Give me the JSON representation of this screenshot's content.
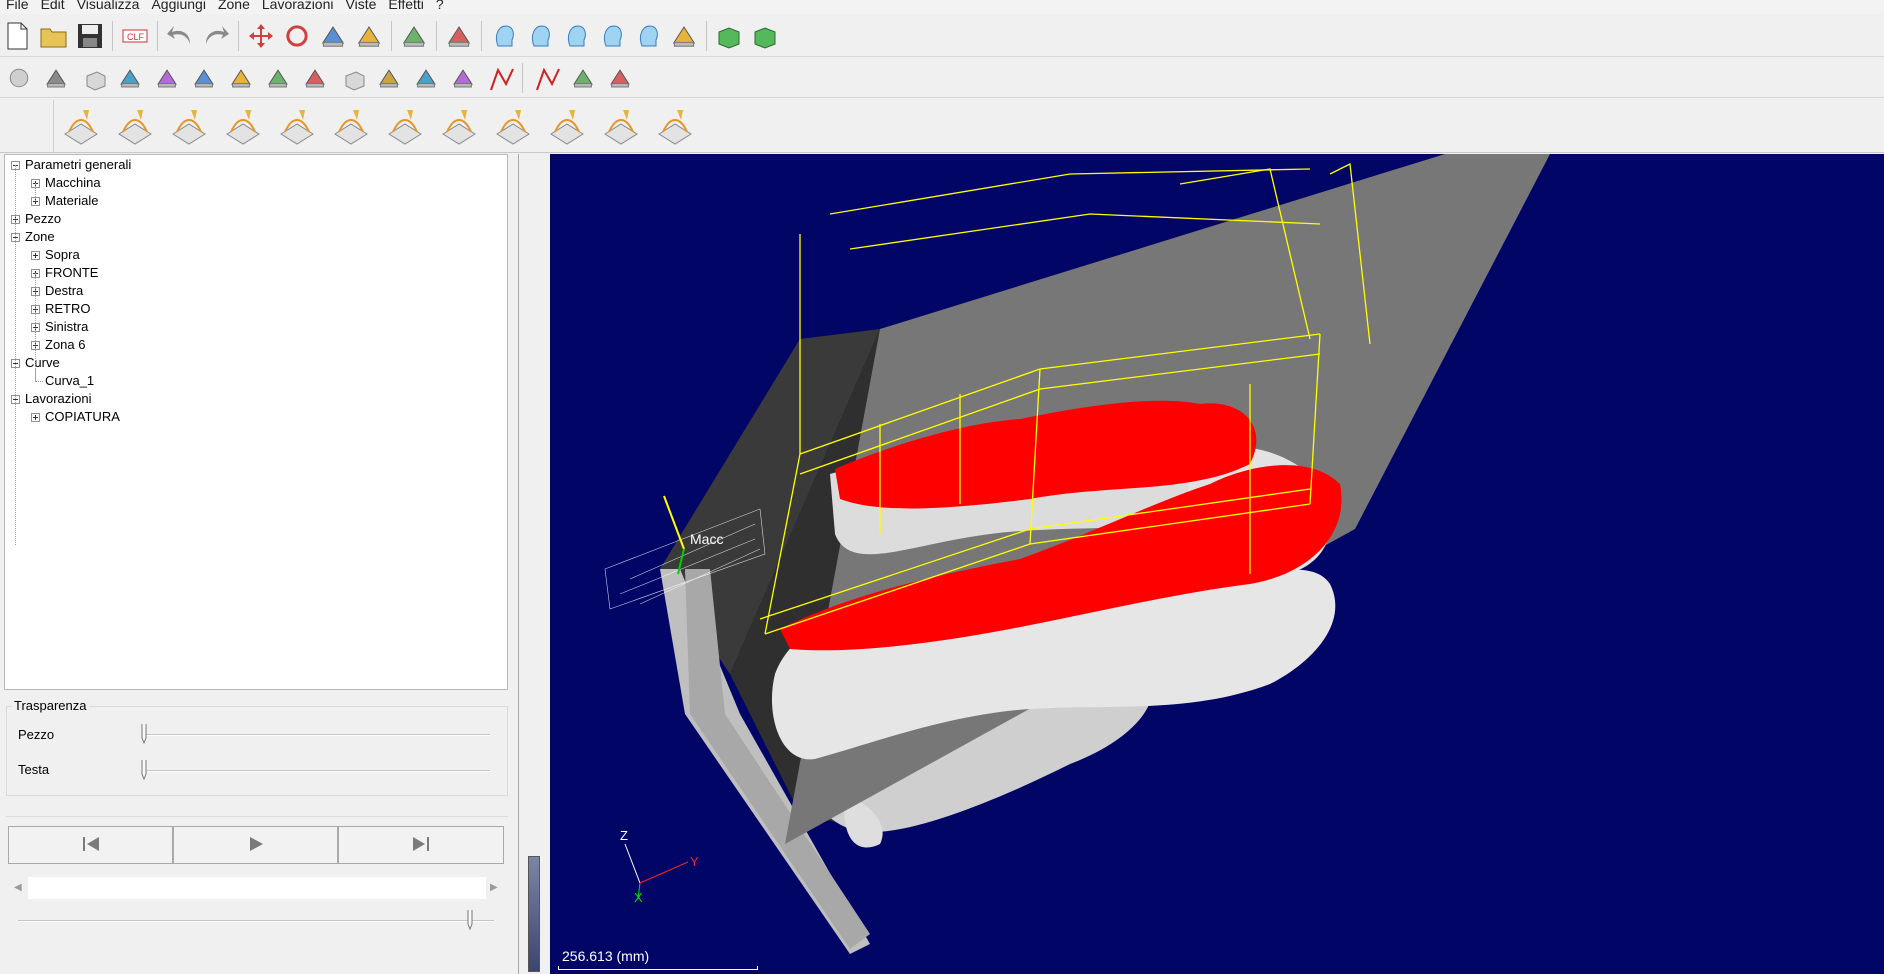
{
  "menu": [
    "File",
    "Edit",
    "Visualizza",
    "Aggiungi",
    "Zone",
    "Lavorazioni",
    "Viste",
    "Effetti",
    "?"
  ],
  "toolbar1": [
    {
      "name": "new-file-icon"
    },
    {
      "name": "open-folder-icon"
    },
    {
      "name": "save-icon"
    },
    {
      "name": "clf-import-icon"
    },
    {
      "name": "undo-icon"
    },
    {
      "name": "redo-icon"
    },
    {
      "name": "move-icon"
    },
    {
      "name": "rotate-icon"
    },
    {
      "name": "scale-icon"
    },
    {
      "name": "cut-icon"
    },
    {
      "name": "layers-icon"
    },
    {
      "name": "relief-icon"
    },
    {
      "name": "head-view-front-icon"
    },
    {
      "name": "head-view-right-icon"
    },
    {
      "name": "head-view-left-icon"
    },
    {
      "name": "hand-view-icon"
    },
    {
      "name": "hand-view-top-icon"
    },
    {
      "name": "plane-view-icon"
    },
    {
      "name": "box-green-icon"
    },
    {
      "name": "box-green-multi-icon"
    }
  ],
  "toolbar1_clf_label": "CLF",
  "toolbar2": [
    "sphere-icon",
    "cone-icon",
    "cube-icon",
    "funnel-icon",
    "plane-cut-icon",
    "dish-icon",
    "ribbon-icon",
    "torus-icon",
    "lathe-icon",
    "box-small-icon",
    "text-icon",
    "curve-surface-icon",
    "path-icon",
    "polyline-icon",
    "polygon-icon",
    "mold-icon",
    "knurl-icon"
  ],
  "toolbar3": [
    "roughing-icon",
    "zigzag-toolpath-icon",
    "pocket-icon",
    "flat-finish-icon",
    "spiral-cone-icon",
    "stepdown-icon",
    "pad-icon",
    "sphere-finish-icon",
    "vase-rotary-icon",
    "vase-rotary-arrows-icon",
    "cone-surface-icon",
    "axis-arrow-icon"
  ],
  "tree": {
    "items": [
      {
        "label": "Parametri generali",
        "level": 0,
        "state": "minus"
      },
      {
        "label": "Macchina",
        "level": 1,
        "state": "plus"
      },
      {
        "label": "Materiale",
        "level": 1,
        "state": "plus"
      },
      {
        "label": "Pezzo",
        "level": 0,
        "state": "plus"
      },
      {
        "label": "Zone",
        "level": 0,
        "state": "minus"
      },
      {
        "label": "Sopra",
        "level": 1,
        "state": "plus"
      },
      {
        "label": "FRONTE",
        "level": 1,
        "state": "plus"
      },
      {
        "label": "Destra",
        "level": 1,
        "state": "plus"
      },
      {
        "label": "RETRO",
        "level": 1,
        "state": "plus"
      },
      {
        "label": "Sinistra",
        "level": 1,
        "state": "plus"
      },
      {
        "label": "Zona 6",
        "level": 1,
        "state": "plus"
      },
      {
        "label": "Curve",
        "level": 0,
        "state": "minus"
      },
      {
        "label": "Curva_1",
        "level": 1,
        "state": "leaf"
      },
      {
        "label": "Lavorazioni",
        "level": 0,
        "state": "minus"
      },
      {
        "label": "COPIATURA",
        "level": 1,
        "state": "plus"
      }
    ]
  },
  "transparency": {
    "title": "Trasparenza",
    "pezzo_label": "Pezzo",
    "pezzo_value": 0,
    "testa_label": "Testa",
    "testa_value": 0
  },
  "playback": {
    "prev": "skip-back-icon",
    "play": "play-icon",
    "next": "skip-forward-icon",
    "speed_value": 0.95
  },
  "viewport": {
    "background": "#010566",
    "machine_label": "Macc",
    "axis_x": "X",
    "axis_y": "Y",
    "axis_z": "Z",
    "scale_text": "256.613 (mm)",
    "colors": {
      "stock": "#777777",
      "model": "#d8d8d8",
      "highlight": "#ff0000",
      "toolpath": "#ffff00"
    }
  }
}
